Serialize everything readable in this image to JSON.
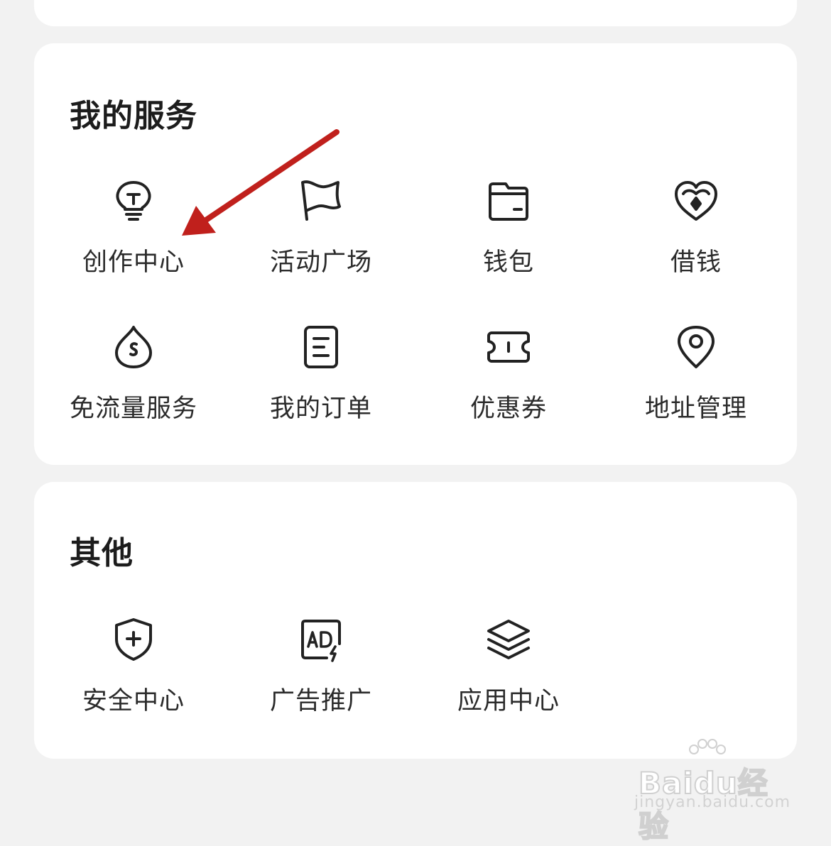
{
  "services": {
    "title": "我的服务",
    "items": [
      {
        "label": "创作中心",
        "icon": "lightbulb-icon"
      },
      {
        "label": "活动广场",
        "icon": "flag-icon"
      },
      {
        "label": "钱包",
        "icon": "wallet-icon"
      },
      {
        "label": "借钱",
        "icon": "heart-coin-icon"
      },
      {
        "label": "免流量服务",
        "icon": "data-drop-icon"
      },
      {
        "label": "我的订单",
        "icon": "order-icon"
      },
      {
        "label": "优惠券",
        "icon": "coupon-icon"
      },
      {
        "label": "地址管理",
        "icon": "location-pin-icon"
      }
    ]
  },
  "other": {
    "title": "其他",
    "items": [
      {
        "label": "安全中心",
        "icon": "shield-plus-icon"
      },
      {
        "label": "广告推广",
        "icon": "ad-icon"
      },
      {
        "label": "应用中心",
        "icon": "layers-icon"
      }
    ]
  },
  "watermark": {
    "brand": "Baidu经验",
    "url": "jingyan.baidu.com"
  },
  "colors": {
    "background": "#f2f2f2",
    "card": "#ffffff",
    "annotation_arrow": "#c0201c"
  }
}
